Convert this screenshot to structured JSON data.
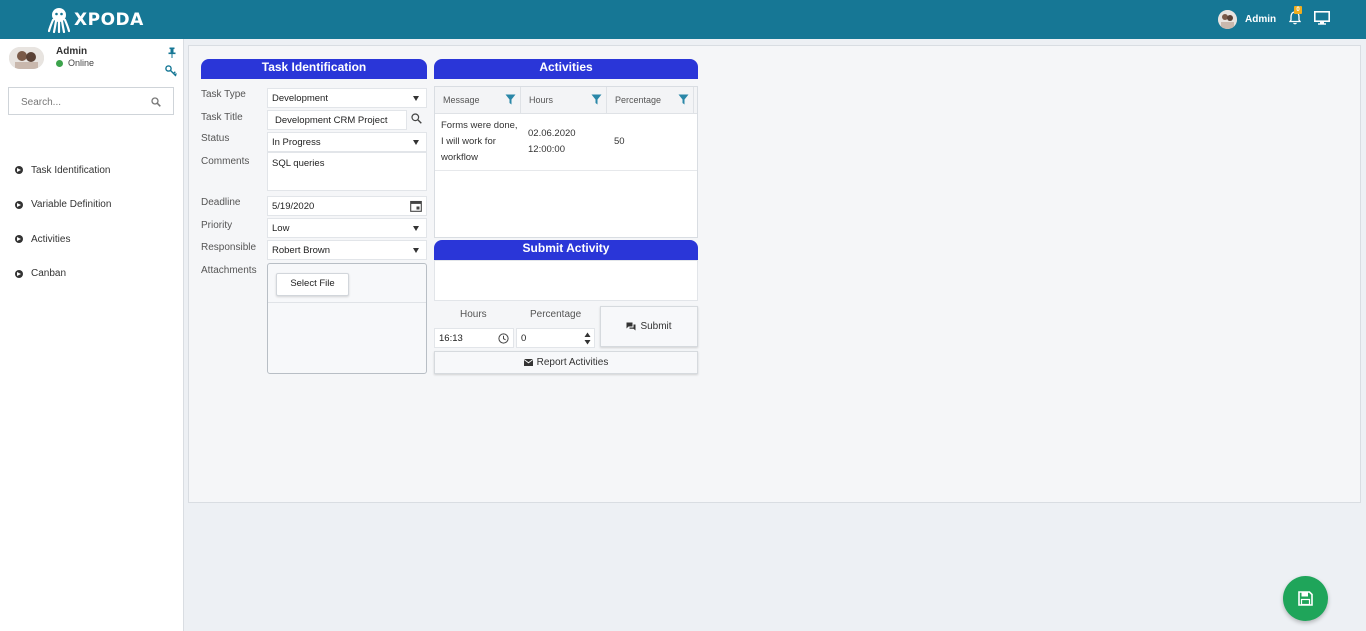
{
  "app": {
    "name": "XPODA"
  },
  "topbar": {
    "user_name": "Admin",
    "notification_count": "0"
  },
  "sidebar": {
    "user_name": "Admin",
    "status": "Online",
    "search_placeholder": "Search...",
    "items": [
      {
        "label": "Task Identification"
      },
      {
        "label": "Variable Definition"
      },
      {
        "label": "Activities"
      },
      {
        "label": "Canban"
      }
    ]
  },
  "task": {
    "header": "Task Identification",
    "labels": {
      "type": "Task Type",
      "title": "Task Title",
      "status": "Status",
      "comments": "Comments",
      "deadline": "Deadline",
      "priority": "Priority",
      "responsible": "Responsible",
      "attachments": "Attachments"
    },
    "values": {
      "type": "Development",
      "title": "Development CRM Project",
      "status": "In Progress",
      "comments": "SQL queries",
      "deadline": "5/19/2020",
      "priority": "Low",
      "responsible": "Robert Brown"
    },
    "select_file_label": "Select File"
  },
  "activities": {
    "header": "Activities",
    "columns": [
      "Message",
      "Hours",
      "Percentage"
    ],
    "rows": [
      {
        "message": "Forms were done, I will work for workflow",
        "hours": "02.06.2020 12:00:00",
        "percentage": "50"
      }
    ]
  },
  "submit_activity": {
    "header": "Submit Activity",
    "hours_label": "Hours",
    "percentage_label": "Percentage",
    "hours_value": "16:13",
    "percentage_value": "0",
    "submit_label": "Submit",
    "report_label": "Report Activities"
  },
  "colors": {
    "topbar": "#167795",
    "section_header": "#2a36d8",
    "fab": "#1fa55a",
    "online": "#3ca34c",
    "filter_icon": "#2a87a8"
  }
}
